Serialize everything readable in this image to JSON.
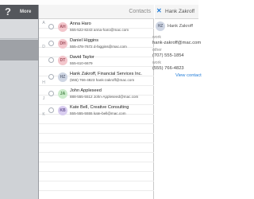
{
  "status_bar": {
    "time": ""
  },
  "sidebar": {
    "help_glyph": "?",
    "more_label": "More"
  },
  "contacts_list": {
    "title": "Contacts",
    "sections": [
      "A",
      "D",
      "H",
      "J",
      "K"
    ],
    "rows": [
      {
        "initials": "AH",
        "name": "Anna Haro",
        "detail": "555-522-8243 anna-haro@mac.com",
        "avatar_bg": "#f3c6cc",
        "avatar_fg": "#a2505e"
      },
      {
        "initials": "DH",
        "name": "Daniel Higgins",
        "detail": "555-478-7672 d-higgins@mac.com",
        "avatar_bg": "#f3c6cc",
        "avatar_fg": "#a2505e"
      },
      {
        "initials": "DT",
        "name": "David Taylor",
        "detail": "555-610-6679",
        "avatar_bg": "#f3c6cc",
        "avatar_fg": "#a2505e"
      },
      {
        "initials": "HZ",
        "name": "Hank Zakroff, Financial Services Inc.",
        "detail": "(555) 766-4823 hank-zakroff@mac.com",
        "avatar_bg": "#cfd6e4",
        "avatar_fg": "#6a7284"
      },
      {
        "initials": "JA",
        "name": "John Appleseed",
        "detail": "888-555-5512 John-Appleseed@mac.com",
        "avatar_bg": "#cdeccd",
        "avatar_fg": "#4f8a4f"
      },
      {
        "initials": "KB",
        "name": "Kate Bell, Creative Consulting",
        "detail": "555-555-5555 kate-bell@mac.com",
        "avatar_bg": "#d9cdf0",
        "avatar_fg": "#6c5a96"
      }
    ]
  },
  "detail_pane": {
    "close_glyph": "✕",
    "title": "Hank Zakroff",
    "avatar_initials": "HZ",
    "name": "Hank Zakroff",
    "fields": [
      {
        "label": "work",
        "value": "hank-zakroff@mac.com"
      },
      {
        "label": "other",
        "value": "(707) 555-1854"
      },
      {
        "label": "work",
        "value": "(555) 766-4823"
      }
    ],
    "view_link": "View contact"
  },
  "colors": {
    "accent": "#1f7bd8",
    "sidebar_dark": "#54575c",
    "sidebar_light": "#cfd2d6"
  }
}
